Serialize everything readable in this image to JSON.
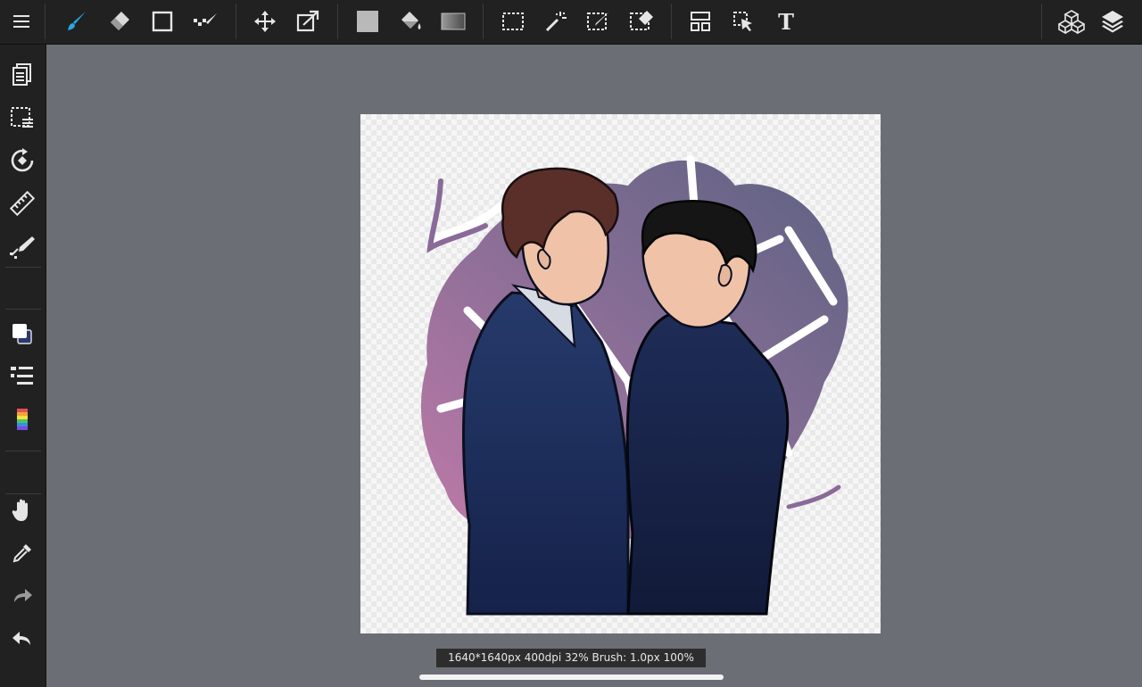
{
  "status_bar": {
    "text": "1640*1640px 400dpi 32% Brush: 1.0px 100%"
  },
  "colors": {
    "toolbar_bg": "#212121",
    "workspace_bg": "#6b6f75",
    "active_tool": "#2aa7e0",
    "icon": "#e6e6e6",
    "icon_muted": "#9a9a9a"
  },
  "toolbar": {
    "tools": [
      {
        "icon": "menu-icon"
      },
      {
        "icon": "brush-icon",
        "active": true
      },
      {
        "icon": "eraser-icon"
      },
      {
        "icon": "shape-rectangle-icon"
      },
      {
        "icon": "smudge-icon"
      },
      {
        "icon": "move-icon"
      },
      {
        "icon": "transform-icon"
      },
      {
        "icon": "fill-color-icon"
      },
      {
        "icon": "bucket-icon"
      },
      {
        "icon": "gradient-icon"
      },
      {
        "icon": "select-rectangle-icon"
      },
      {
        "icon": "magic-wand-icon"
      },
      {
        "icon": "select-pen-icon"
      },
      {
        "icon": "select-eraser-icon"
      },
      {
        "icon": "frame-divider-icon"
      },
      {
        "icon": "operation-icon"
      },
      {
        "icon": "text-icon"
      },
      {
        "icon": "materials-icon"
      },
      {
        "icon": "layers-icon"
      }
    ],
    "text_glyph": "T"
  },
  "sidebar": {
    "tools": [
      {
        "icon": "pages-icon"
      },
      {
        "icon": "selection-layer-icon"
      },
      {
        "icon": "rotate-icon"
      },
      {
        "icon": "ruler-icon"
      },
      {
        "icon": "snap-pen-icon"
      },
      {
        "icon": "color-swatch-icon"
      },
      {
        "icon": "brush-list-icon"
      },
      {
        "icon": "color-palette-icon"
      },
      {
        "icon": "hand-icon"
      },
      {
        "icon": "eyedropper-icon"
      },
      {
        "icon": "redo-icon"
      },
      {
        "icon": "undo-icon"
      }
    ]
  }
}
